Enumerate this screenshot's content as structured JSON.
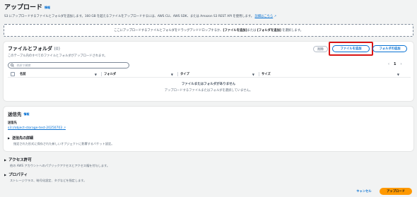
{
  "page": {
    "title": "アップロード",
    "info": "情報",
    "description": "S3 にアップロードするファイルとフォルダを追加します。160 GB を超えるファイルをアップロードするには、AWS CLI、AWS SDK、または Amazon S3 REST API を使用します。",
    "description_link": "詳細はこちら"
  },
  "dropzone": {
    "prefix": "ここにアップロードするファイルとフォルダをドラッグアンドドロップするか、",
    "add_files": "[ファイルを追加]",
    "middle": "または",
    "add_folder": "[フォルダを追加]",
    "suffix": "を選択します。"
  },
  "files_panel": {
    "title": "ファイルとフォルダ",
    "count": "(0)",
    "subtitle": "このテーブル内のすべてのファイルとフォルダがアップロードされます。",
    "delete_label": "削除",
    "add_files_label": "ファイルを追加",
    "add_folder_label": "フォルダの追加",
    "search_placeholder": "名前で検索",
    "page_number": "1",
    "columns": [
      "名前",
      "フォルダ",
      "タイプ",
      "サイズ"
    ],
    "empty_title": "ファイルまたはフォルダがありません",
    "empty_message": "アップロードするファイルまたはフォルダを選択していません。"
  },
  "destination": {
    "title": "送信先",
    "info": "情報",
    "label": "送信先",
    "link": "s3://object-storage-test-20250703",
    "details_title": "送信先の詳細",
    "details_sub": "指定された形式に保存された新しいオブジェクトに影響するバケット設定。"
  },
  "permissions": {
    "title": "アクセス許可",
    "sub": "他の AWS アカウントへのパブリックアクセスとアクセス権を付与します。"
  },
  "properties": {
    "title": "プロパティ",
    "sub": "ストレージクラス、暗号化設定、タグなどを指定します。"
  },
  "footer": {
    "cancel_label": "キャンセル",
    "upload_label": "アップロード"
  },
  "colors": {
    "link": "#0972d3",
    "primary": "#ff9900",
    "highlight": "#d91515"
  }
}
